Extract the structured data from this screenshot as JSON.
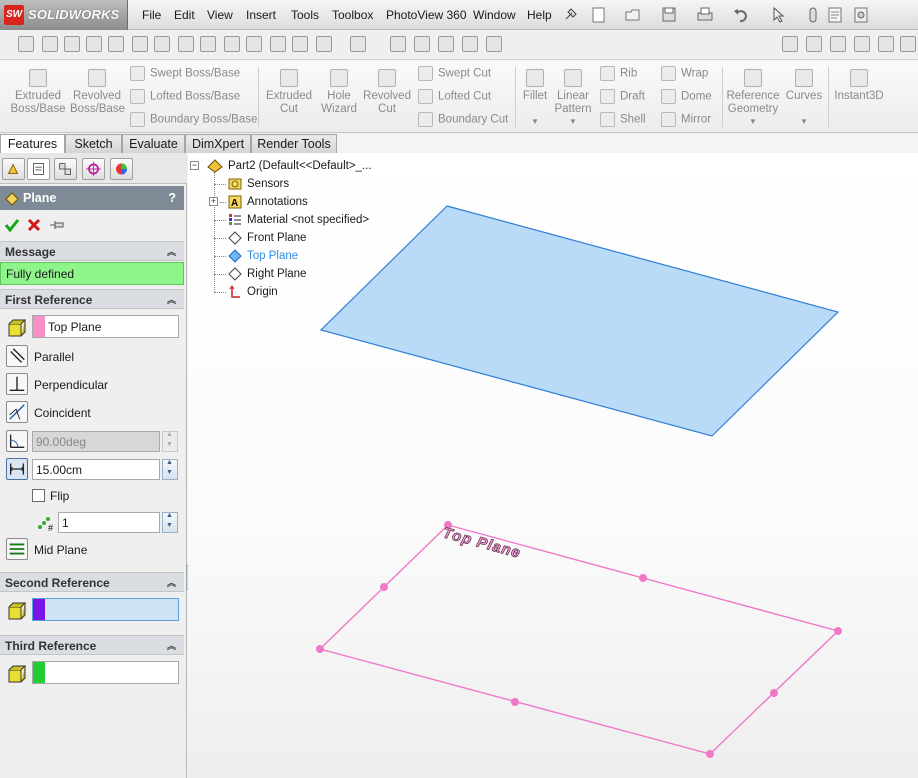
{
  "app": {
    "logo_text": "SOLIDWORKS",
    "logo_mark": "SW",
    "menu": [
      "File",
      "Edit",
      "View",
      "Insert",
      "Tools",
      "Toolbox",
      "PhotoView 360",
      "Window",
      "Help"
    ]
  },
  "command_manager": {
    "extruded_boss": "Extruded Boss/Base",
    "revolved_boss": "Revolved Boss/Base",
    "swept_boss": "Swept Boss/Base",
    "lofted_boss": "Lofted Boss/Base",
    "boundary_boss": "Boundary Boss/Base",
    "extruded_cut": "Extruded Cut",
    "hole_wizard": "Hole Wizard",
    "revolved_cut": "Revolved Cut",
    "swept_cut": "Swept Cut",
    "lofted_cut": "Lofted Cut",
    "boundary_cut": "Boundary Cut",
    "fillet": "Fillet",
    "linear_pattern": "Linear Pattern",
    "rib": "Rib",
    "draft": "Draft",
    "shell": "Shell",
    "wrap": "Wrap",
    "dome": "Dome",
    "mirror": "Mirror",
    "reference_geometry": "Reference Geometry",
    "curves": "Curves",
    "instant3d": "Instant3D"
  },
  "tabs": [
    "Features",
    "Sketch",
    "Evaluate",
    "DimXpert",
    "Render Tools"
  ],
  "active_tab": "Features",
  "property_manager": {
    "title": "Plane",
    "help": "?",
    "message": {
      "header": "Message",
      "text": "Fully defined"
    },
    "first_reference": {
      "header": "First Reference",
      "selection": "Top Plane",
      "parallel": "Parallel",
      "perpendicular": "Perpendicular",
      "coincident": "Coincident",
      "angle": "90.00deg",
      "distance": "15.00cm",
      "flip": "Flip",
      "instances": "1",
      "mid_plane": "Mid Plane"
    },
    "second_reference": {
      "header": "Second Reference",
      "selection": ""
    },
    "third_reference": {
      "header": "Third Reference",
      "selection": ""
    }
  },
  "feature_tree": {
    "root": "Part2  (Default<<Default>_...",
    "items": [
      {
        "label": "Sensors"
      },
      {
        "label": "Annotations"
      },
      {
        "label": "Material <not specified>"
      },
      {
        "label": "Front Plane"
      },
      {
        "label": "Top Plane"
      },
      {
        "label": "Right Plane"
      },
      {
        "label": "Origin"
      }
    ]
  },
  "graphics": {
    "plane_label": "Top Plane"
  },
  "colors": {
    "first_ref_swatch": "#f78fc9",
    "second_ref_swatch": "#7a13e6",
    "third_ref_swatch": "#22cc33",
    "message_bg": "#8ef58a",
    "new_plane_fill": "#b9dbf7",
    "new_plane_stroke": "#2f7fd6",
    "top_plane_stroke": "#f078c8",
    "highlight_text": "#2f8fe8"
  }
}
